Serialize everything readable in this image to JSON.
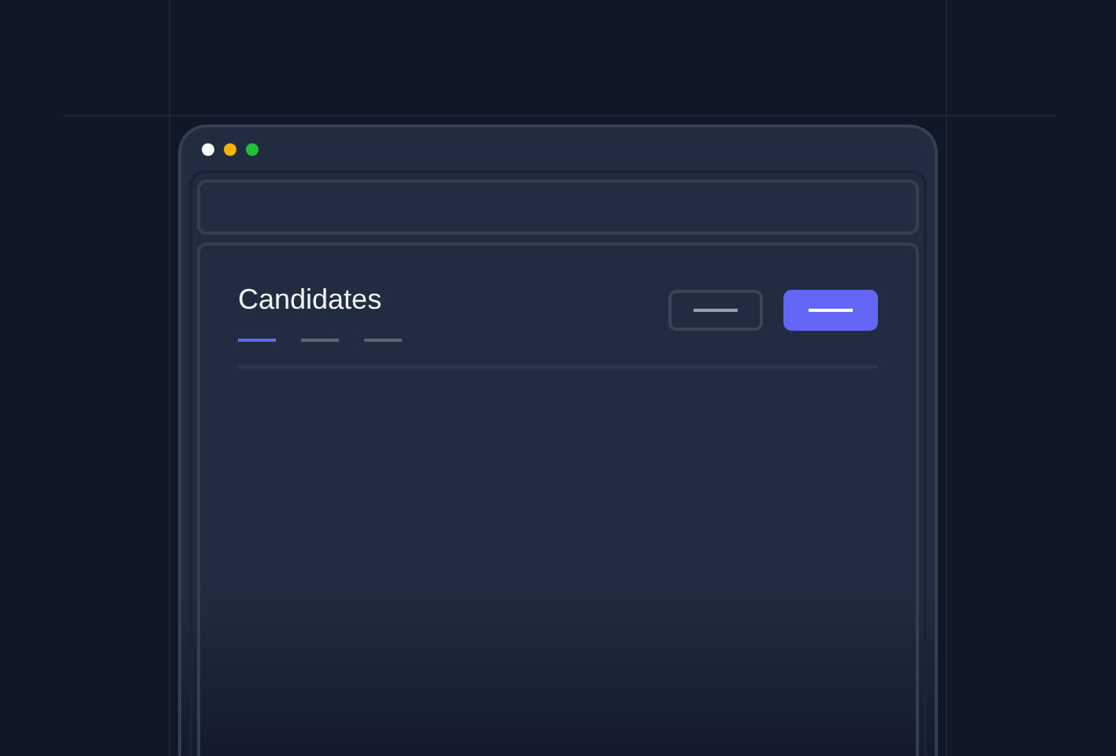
{
  "window": {
    "dots": [
      {
        "color": "#ffffff"
      },
      {
        "color": "#f5b400"
      },
      {
        "color": "#1fc23a"
      }
    ]
  },
  "page": {
    "title": "Candidates",
    "tabs": [
      {
        "selected": true
      },
      {
        "selected": false
      },
      {
        "selected": false
      }
    ],
    "buttons": [
      {
        "kind": "outline"
      },
      {
        "kind": "primary"
      }
    ]
  }
}
